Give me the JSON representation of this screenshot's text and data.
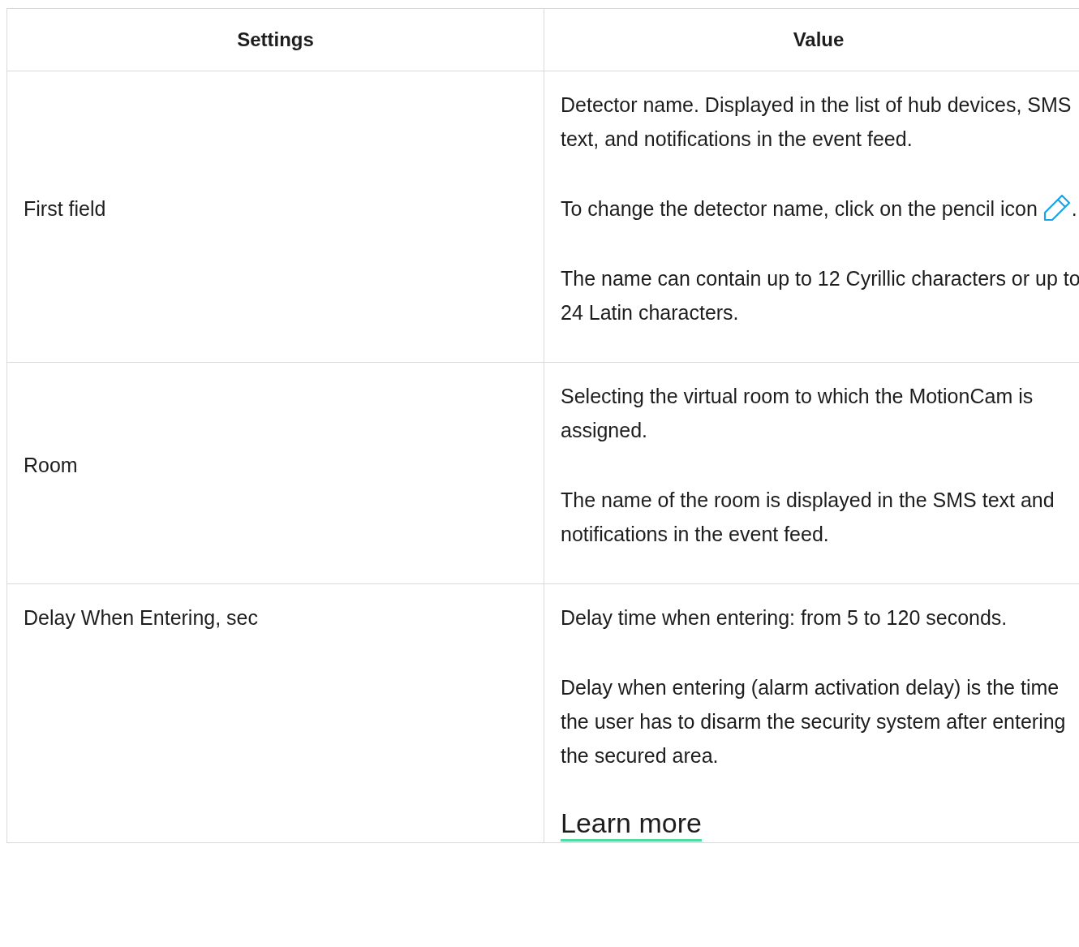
{
  "table": {
    "columns": [
      "Settings",
      "Value"
    ],
    "rows": [
      {
        "setting": "First field",
        "paragraphs": [
          {
            "kind": "text",
            "text": "Detector name. Displayed in the list of hub devices, SMS text, and notifications in the event feed."
          },
          {
            "kind": "icon-text",
            "text": "To change the detector name, click on the pencil icon",
            "after": "."
          },
          {
            "kind": "text",
            "text": "The name can contain up to 12 Cyrillic characters or up to 24 Latin characters."
          }
        ]
      },
      {
        "setting": "Room",
        "paragraphs": [
          {
            "kind": "text",
            "text": "Selecting the virtual room to which the MotionCam is assigned."
          },
          {
            "kind": "text",
            "text": "The name of the room is displayed in the SMS text and notifications in the event feed."
          }
        ]
      },
      {
        "setting": "Delay When Entering, sec",
        "paragraphs": [
          {
            "kind": "text",
            "text": "Delay time when entering: from 5 to 120 seconds."
          },
          {
            "kind": "text",
            "text": "Delay when entering (alarm activation delay) is the time the user has to disarm the security system after entering the secured area."
          },
          {
            "kind": "link",
            "text": "Learn more"
          }
        ]
      }
    ]
  }
}
